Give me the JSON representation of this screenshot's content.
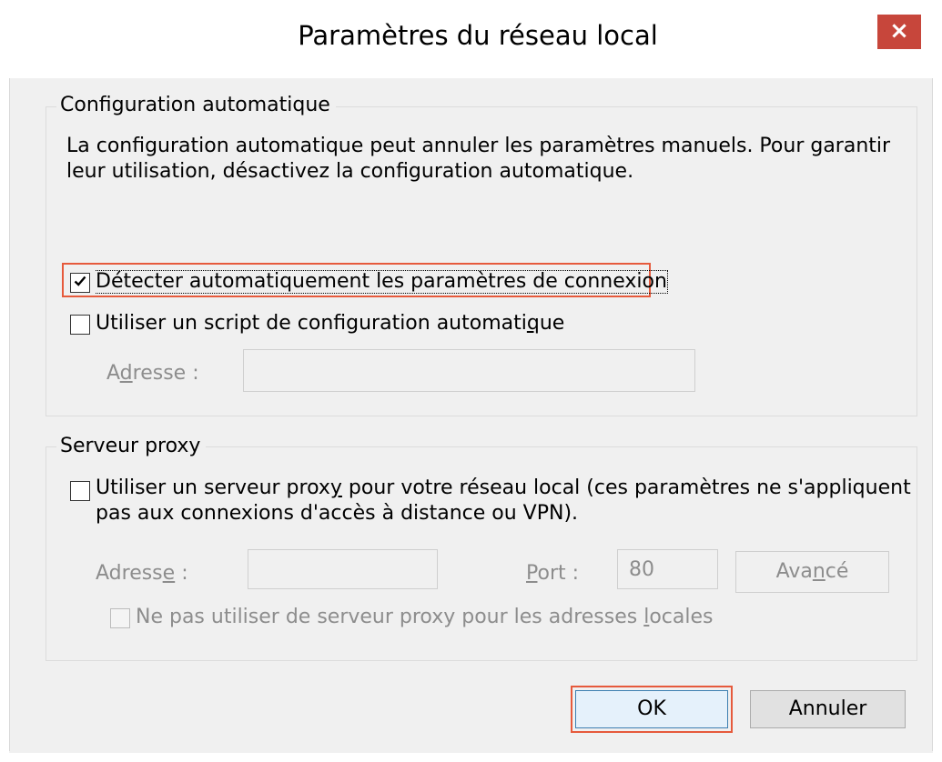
{
  "window": {
    "title": "Paramètres du réseau local",
    "close_glyph": "×",
    "colors": {
      "close": "#c7463b",
      "focus_highlight": "#e65a3c"
    }
  },
  "auto_config": {
    "legend": "Configuration automatique",
    "description_line1": "La configuration automatique peut annuler les paramètres manuels. Pour garantir",
    "description_line2": "leur utilisation, désactivez la configuration automatique.",
    "detect_checkbox": {
      "label": "Détecter automatiquement les paramètres de connexion",
      "checked": true
    },
    "script_checkbox": {
      "label_before": "Utiliser un script de configuration automati",
      "label_mnemonic": "q",
      "label_after": "ue",
      "checked": false
    },
    "address": {
      "label_before": "A",
      "label_mnemonic": "d",
      "label_after": "resse :",
      "value": ""
    }
  },
  "proxy": {
    "legend": "Serveur proxy",
    "use_proxy_checkbox": {
      "label_line1_before": "Utiliser un serveur prox",
      "label_line1_mnemonic": "y",
      "label_line1_after": " pour votre réseau local (ces paramètres ne s'appliquent",
      "label_line2": "pas aux connexions d'accès à distance ou VPN).",
      "checked": false
    },
    "address": {
      "label_before": "Adress",
      "label_mnemonic": "e",
      "label_after": " :",
      "value": ""
    },
    "port": {
      "label_before": "",
      "label_mnemonic": "P",
      "label_after": "ort :",
      "value": "80"
    },
    "advanced_button": {
      "label_before": "Ava",
      "label_mnemonic": "n",
      "label_after": "cé"
    },
    "bypass_local_checkbox": {
      "label_before": "Ne pas utiliser de serveur proxy pour les adresses ",
      "label_mnemonic": "l",
      "label_after": "ocales",
      "checked": false
    }
  },
  "buttons": {
    "ok": "OK",
    "cancel": "Annuler"
  }
}
